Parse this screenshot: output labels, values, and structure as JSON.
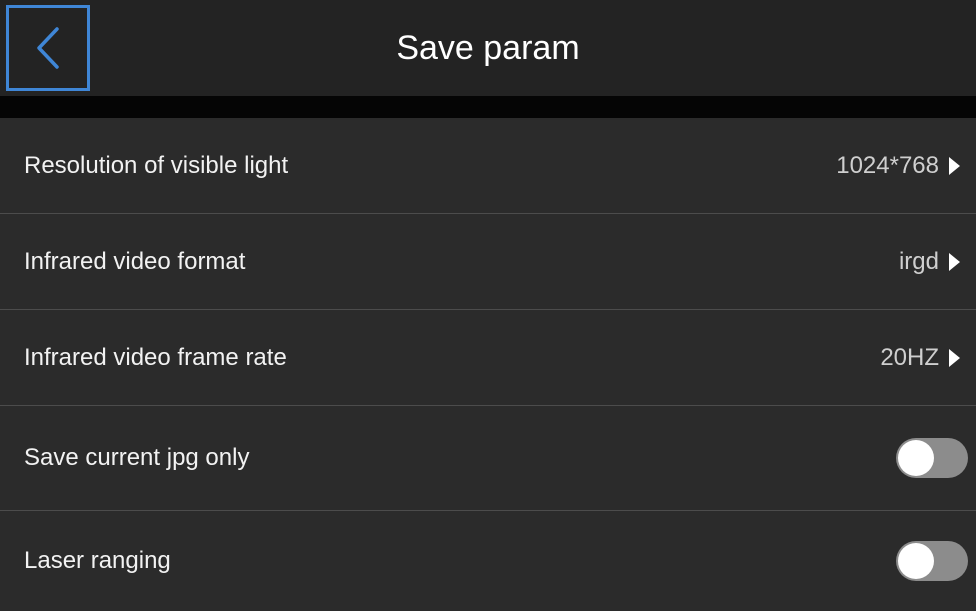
{
  "header": {
    "title": "Save param",
    "back_icon": "chevron-left-icon",
    "accent_color": "#3f86d6"
  },
  "settings": [
    {
      "label": "Resolution of visible light",
      "value": "1024*768",
      "type": "select"
    },
    {
      "label": "Infrared video format",
      "value": "irgd",
      "type": "select"
    },
    {
      "label": "Infrared video frame rate",
      "value": "20HZ",
      "type": "select"
    },
    {
      "label": "Save current jpg only",
      "type": "toggle",
      "enabled": false
    },
    {
      "label": "Laser ranging",
      "type": "toggle",
      "enabled": false
    }
  ]
}
